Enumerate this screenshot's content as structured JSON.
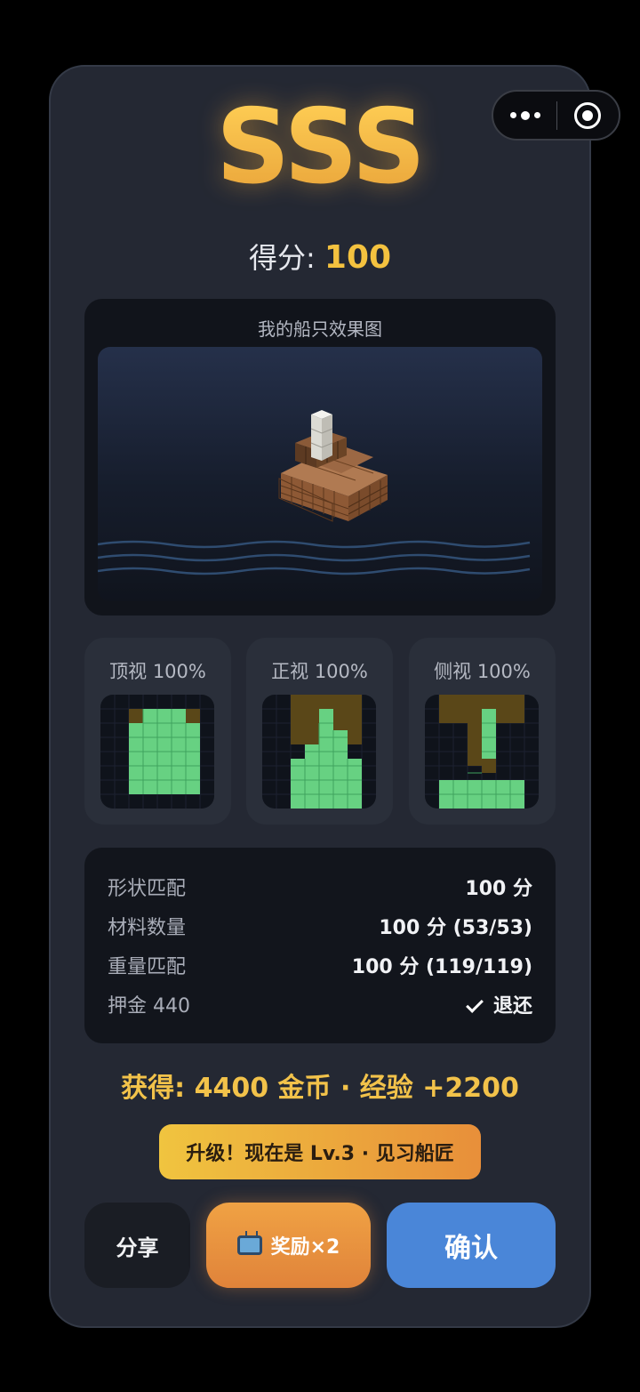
{
  "result": {
    "grade": "SSS",
    "score_label": "得分:",
    "score_value": "100"
  },
  "preview": {
    "title": "我的船只效果图"
  },
  "views": [
    {
      "label": "顶视 100%",
      "match": 1.0
    },
    {
      "label": "正视 100%",
      "match": 1.0
    },
    {
      "label": "侧视 100%",
      "match": 1.0
    }
  ],
  "stats": [
    {
      "key": "形状匹配",
      "value": "100 分"
    },
    {
      "key": "材料数量",
      "value": "100 分 (53/53)"
    },
    {
      "key": "重量匹配",
      "value": "100 分 (119/119)"
    },
    {
      "key": "押金 440",
      "value": "退还"
    }
  ],
  "reward_text": "获得: 4400 金币 · 经验 +2200",
  "levelup_text": "升级！现在是 Lv.3 · 见习船匠",
  "buttons": {
    "share": "分享",
    "double": "奖励×2",
    "confirm": "确认"
  },
  "colors": {
    "match": "#67d182",
    "target": "#5a4718",
    "wood": "#a4663f",
    "mast": "#ecebe6"
  }
}
